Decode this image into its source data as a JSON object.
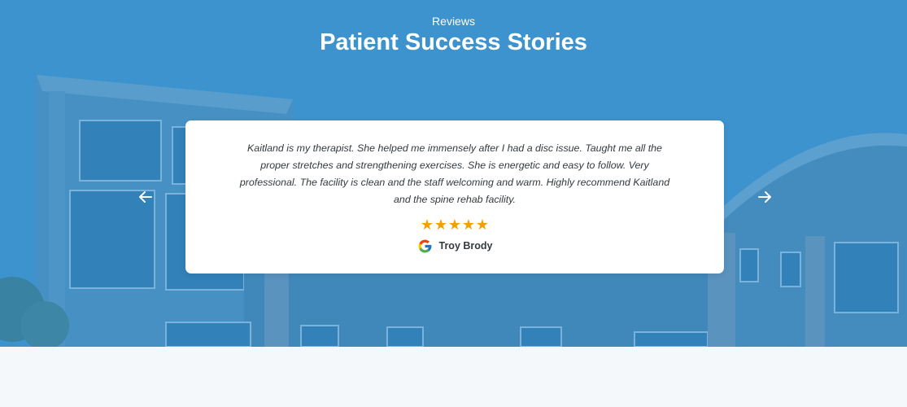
{
  "section": {
    "eyebrow": "Reviews",
    "title": "Patient Success Stories"
  },
  "testimonial": {
    "quote": "Kaitland is my therapist. She helped me immensely after I had a disc issue. Taught me all the proper stretches and strengthening exercises. She is energetic and easy to follow. Very professional. The facility is clean and the staff welcoming and warm. Highly recommend Kaitland and the spine rehab facility.",
    "rating": 5,
    "author": "Troy Brody",
    "source_icon": "google-icon"
  },
  "navigation": {
    "prev_icon": "arrow-left-icon",
    "next_icon": "arrow-right-icon"
  },
  "colors": {
    "hero_blue": "#3b8fc8",
    "star": "#f4a000",
    "card": "#ffffff",
    "text": "#333a40",
    "lower_bg": "#f4f8fb"
  }
}
